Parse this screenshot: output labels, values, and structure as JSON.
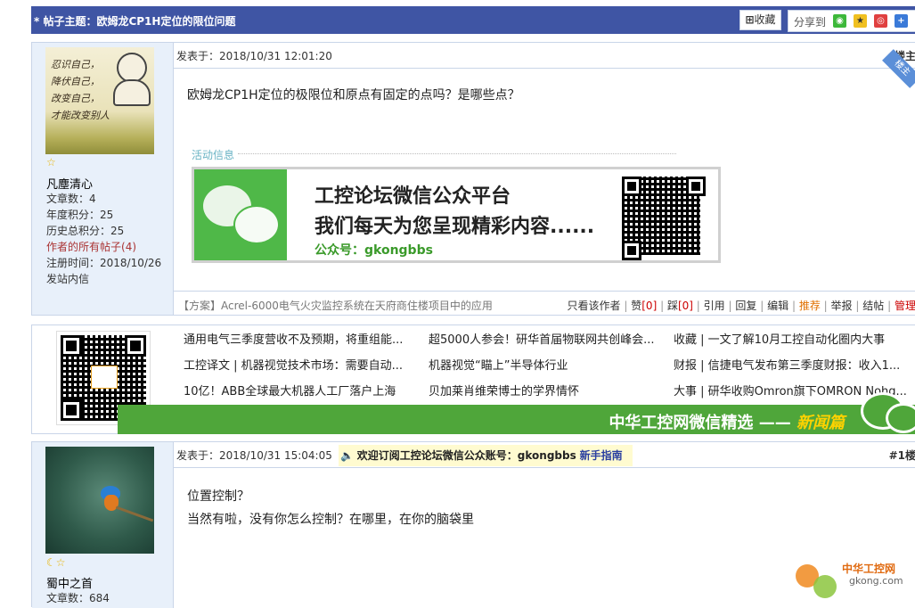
{
  "thread": {
    "title": "* 帖子主题：欧姆龙CP1H定位的限位问题",
    "favorite_label": "收藏",
    "share_label": "分享到"
  },
  "post1": {
    "user": {
      "name": "凡塵清心",
      "posts": "文章数：4",
      "year_points": "年度积分：25",
      "total_points": "历史总积分：25",
      "all_posts_link": "作者的所有帖子",
      "all_posts_count": "(4)",
      "register": "注册时间：2018/10/26",
      "message": "发站内信",
      "avatar_poem": [
        "忍识自己，",
        "降伏自己，",
        "改变自己，",
        "才能改变别人"
      ]
    },
    "meta": "发表于：2018/10/31 12:01:20",
    "floor": "楼主",
    "corner_tag": "楼主",
    "content": "欧姆龙CP1H定位的极限位和原点有固定的点吗？是哪些点？",
    "activity_label": "活动信息",
    "banner": {
      "line1": "工控论坛微信公众平台",
      "line2": "我们每天为您呈现精彩内容......",
      "line3": "公众号：gkongbbs"
    },
    "promo": "【方案】Acrel-6000电气火灾监控系统在天府商住楼项目中的应用",
    "actions": {
      "only_author": "只看该作者",
      "like": "赞",
      "like_count": "[0]",
      "dislike": "踩",
      "dislike_count": "[0]",
      "quote": "引用",
      "reply": "回复",
      "edit": "编辑",
      "recommend": "推荐",
      "report": "举报",
      "close": "结帖",
      "manage": "管理"
    }
  },
  "news": {
    "rows": [
      [
        "通用电气三季度营收不及预期，将重组能...",
        "超5000人参会！研华首届物联网共创峰会...",
        "收藏 | 一文了解10月工控自动化圈内大事"
      ],
      [
        "工控译文 | 机器视觉技术市场：需要自动...",
        "机器视觉“瞄上”半导体行业",
        "财报 | 信捷电气发布第三季度财报：收入1..."
      ],
      [
        "10亿！ABB全球最大机器人工厂落户上海",
        "贝加莱肖维荣博士的学界情怀",
        "大事 | 研华收购Omron旗下OMRON Nohg..."
      ]
    ],
    "band_title": "中华工控网微信精选 ——",
    "band_em": "新闻篇"
  },
  "post2": {
    "user": {
      "name": "蜀中之首",
      "posts": "文章数：684"
    },
    "meta": "发表于：2018/10/31 15:04:05",
    "notice": "欢迎订阅工控论坛微信公众账号：gkongbbs",
    "notice_link": "新手指南",
    "floor": "#1楼",
    "lines": [
      "位置控制？",
      "当然有啦，没有你怎么控制？在哪里，在你的脑袋里"
    ]
  },
  "logo": {
    "name": "中华工控网",
    "domain": "gkong.com"
  }
}
